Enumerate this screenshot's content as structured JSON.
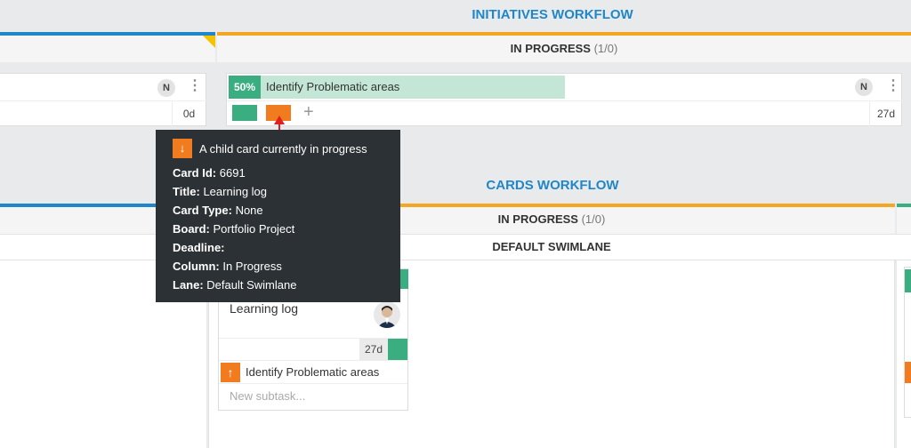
{
  "initiatives": {
    "title": "INITIATIVES WORKFLOW",
    "column": {
      "name": "IN PROGRESS",
      "count": "(1/0)"
    },
    "left_card": {
      "badge": "N",
      "days": "0d"
    },
    "card": {
      "percent": "50%",
      "title": "Identify Problematic areas",
      "badge": "N",
      "days": "27d",
      "add_symbol": "+"
    }
  },
  "tooltip": {
    "heading": "A child card currently in progress",
    "arrow": "↓",
    "rows": [
      {
        "label": "Card Id:",
        "value": "6691"
      },
      {
        "label": "Title:",
        "value": "Learning log"
      },
      {
        "label": "Card Type:",
        "value": "None"
      },
      {
        "label": "Board:",
        "value": "Portfolio Project"
      },
      {
        "label": "Deadline:",
        "value": ""
      },
      {
        "label": "Column:",
        "value": "In Progress"
      },
      {
        "label": "Lane:",
        "value": "Default Swimlane"
      }
    ]
  },
  "cards_workflow": {
    "title": "CARDS WORKFLOW",
    "column": {
      "name": "IN PROGRESS",
      "count": "(1/0)"
    },
    "lane": "DEFAULT SWIMLANE",
    "card": {
      "title": "Learning log",
      "days": "27d",
      "parent_arrow": "↑",
      "parent_title": "Identify Problematic areas",
      "subtask_placeholder": "New subtask..."
    }
  },
  "colors": {
    "accent_blue": "#1f87c9",
    "progress_orange": "#f5a623",
    "green": "#3aae80",
    "orange": "#f07c1f",
    "tooltip_bg": "#2b3134"
  },
  "icons": [
    "kebab-icon",
    "plus-icon",
    "arrow-down-icon",
    "arrow-up-icon",
    "avatar"
  ]
}
